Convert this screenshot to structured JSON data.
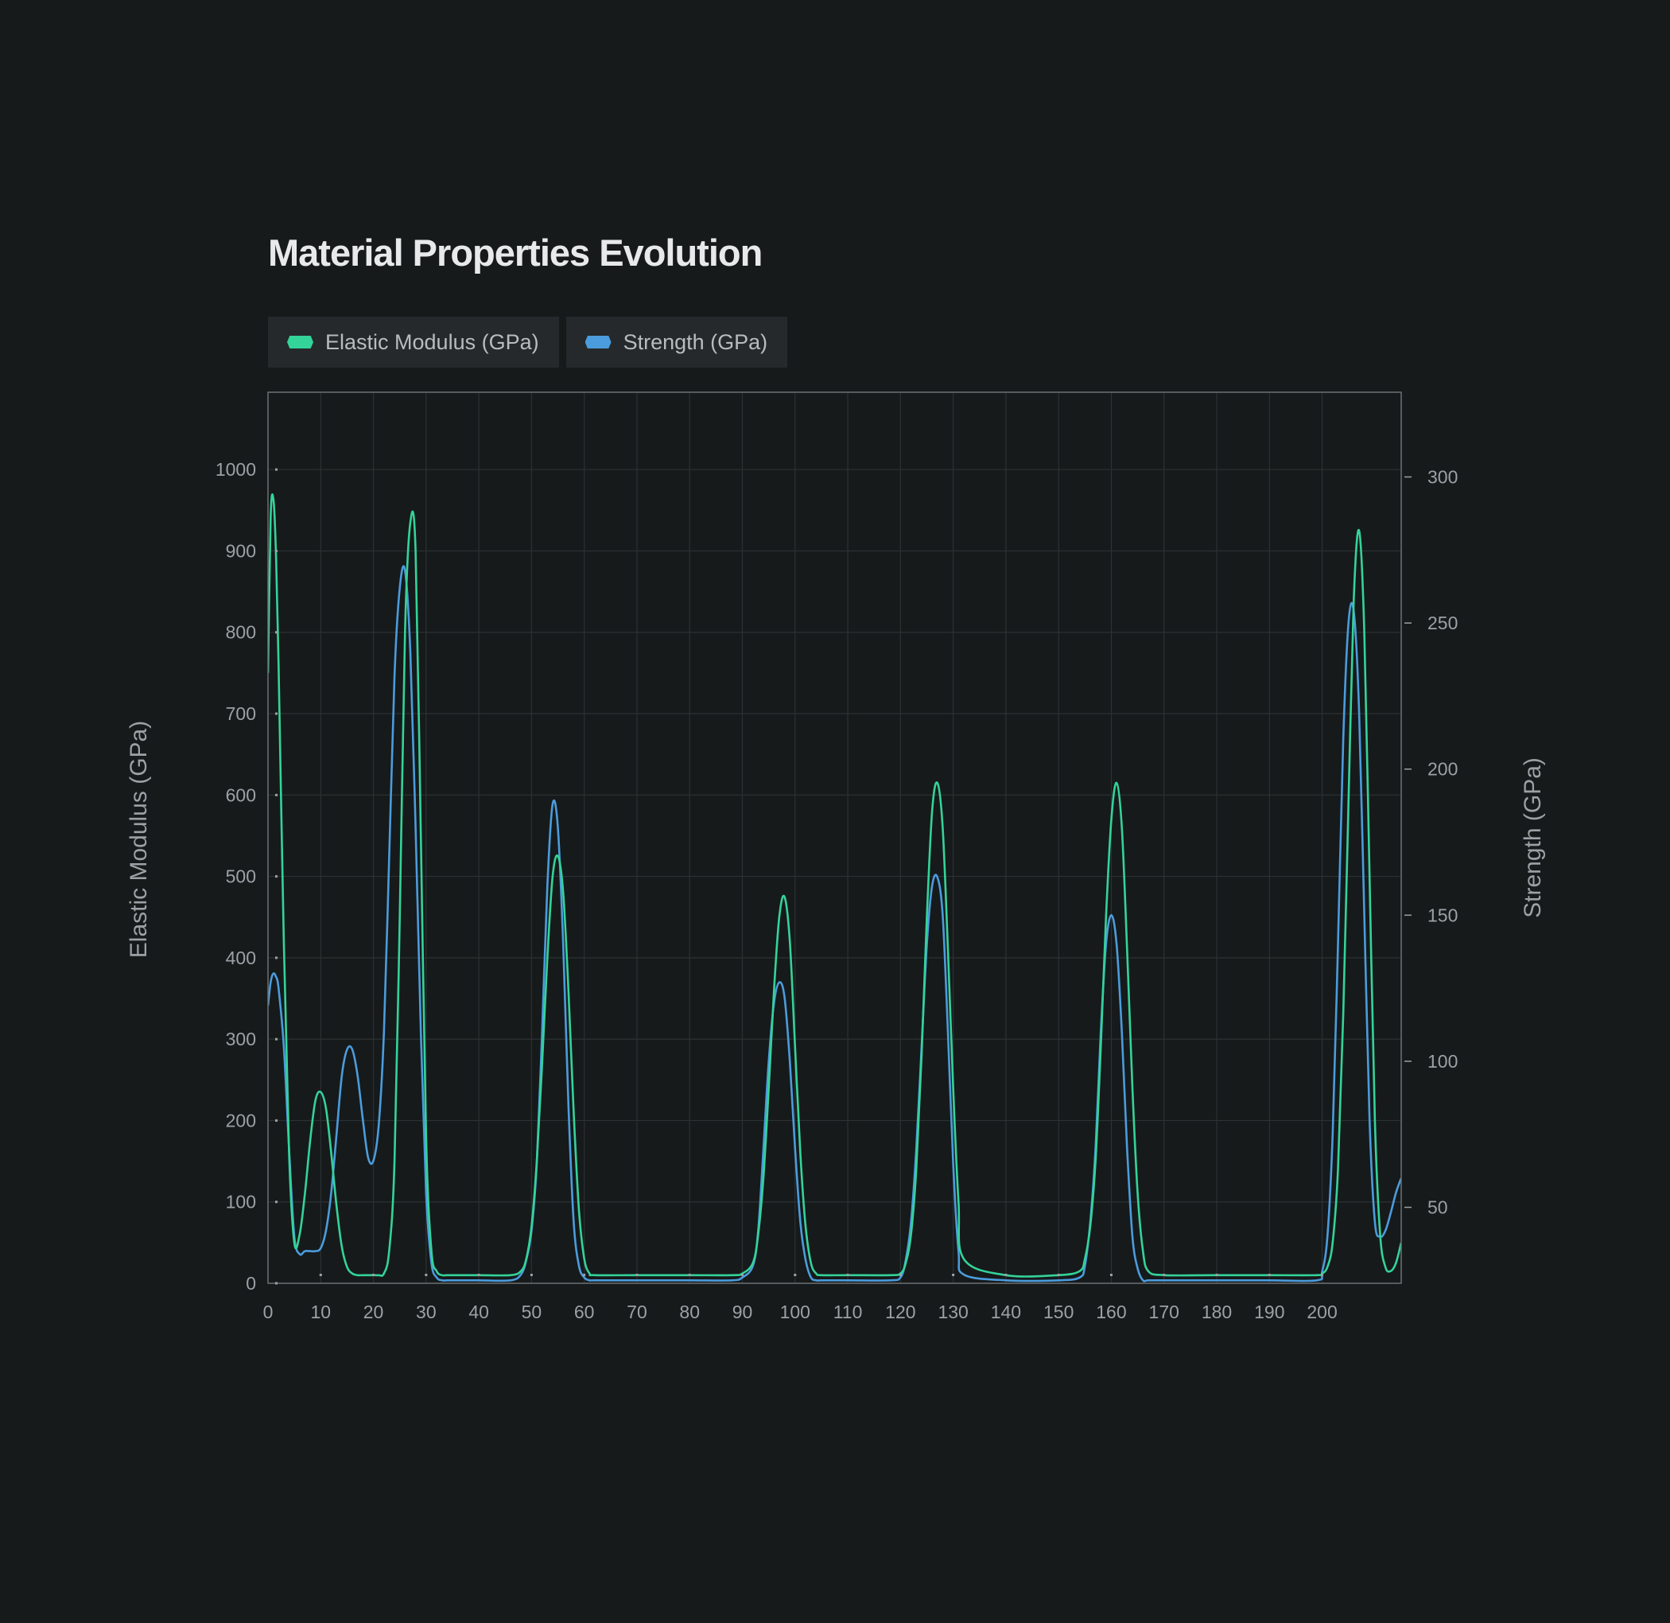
{
  "chart_data": {
    "type": "line",
    "title": "Material Properties Evolution",
    "xlabel": "",
    "ylabel": "Elastic Modulus (GPa)",
    "y2label": "Strength (GPa)",
    "xlim": [
      0,
      215
    ],
    "ylim": [
      0,
      1095
    ],
    "y2lim": [
      24,
      329
    ],
    "x_ticks": [
      0,
      10,
      20,
      30,
      40,
      50,
      60,
      70,
      80,
      90,
      100,
      110,
      120,
      130,
      140,
      150,
      160,
      170,
      180,
      190,
      200
    ],
    "y_ticks": [
      0,
      100,
      200,
      300,
      400,
      500,
      600,
      700,
      800,
      900,
      1000
    ],
    "y2_ticks": [
      50,
      100,
      150,
      200,
      250,
      300
    ],
    "grid": true,
    "legend_position": "top-left",
    "series": [
      {
        "name": "Elastic Modulus (GPa)",
        "axis": "left",
        "color": "#34d399",
        "x": [
          0,
          0.5,
          1,
          1.5,
          2,
          3,
          4,
          5,
          6,
          7,
          8,
          9,
          10,
          11,
          12,
          13,
          14,
          15,
          16,
          17,
          18,
          19,
          20,
          21,
          22,
          23,
          24,
          25,
          26,
          27,
          28,
          29,
          30,
          31,
          32,
          33,
          34,
          35,
          36,
          40,
          46,
          48,
          49,
          50,
          51,
          52,
          53,
          54,
          55,
          56,
          57,
          58,
          59,
          60,
          61,
          62,
          70,
          80,
          88,
          90,
          92,
          93,
          94,
          95,
          96,
          97,
          98,
          99,
          100,
          101,
          102,
          103,
          104,
          105,
          110,
          118,
          120,
          121,
          122,
          123,
          124,
          125,
          126,
          127,
          128,
          129,
          130,
          131,
          132,
          140,
          150,
          154,
          155,
          156,
          157,
          158,
          159,
          160,
          161,
          162,
          163,
          164,
          165,
          166,
          167,
          170,
          180,
          190,
          199,
          200,
          201,
          202,
          203,
          204,
          205,
          206,
          207,
          208,
          209,
          210,
          211,
          212,
          213,
          214,
          215
        ],
        "values": [
          750,
          940,
          965,
          900,
          760,
          420,
          160,
          50,
          60,
          110,
          175,
          225,
          235,
          215,
          160,
          95,
          45,
          20,
          12,
          10,
          10,
          10,
          10,
          10,
          12,
          40,
          150,
          450,
          800,
          935,
          900,
          550,
          180,
          40,
          15,
          10,
          10,
          10,
          10,
          10,
          10,
          15,
          30,
          70,
          150,
          270,
          400,
          500,
          525,
          480,
          360,
          210,
          90,
          30,
          12,
          10,
          10,
          10,
          10,
          12,
          25,
          60,
          130,
          240,
          360,
          450,
          475,
          420,
          290,
          160,
          70,
          25,
          12,
          10,
          10,
          10,
          12,
          25,
          60,
          140,
          280,
          450,
          580,
          615,
          560,
          410,
          240,
          100,
          30,
          10,
          10,
          15,
          30,
          70,
          150,
          290,
          450,
          570,
          615,
          560,
          410,
          240,
          110,
          40,
          15,
          10,
          10,
          10,
          10,
          12,
          20,
          50,
          140,
          330,
          590,
          840,
          925,
          800,
          500,
          200,
          60,
          20,
          15,
          25,
          50
        ]
      },
      {
        "name": "Strength (GPa)",
        "axis": "right",
        "color": "#4b9cdc",
        "x": [
          0,
          0.5,
          1,
          1.5,
          2,
          3,
          4,
          5,
          6,
          7,
          8,
          9,
          10,
          11,
          12,
          13,
          14,
          15,
          16,
          17,
          18,
          19,
          20,
          21,
          22,
          23,
          24,
          25,
          26,
          27,
          28,
          29,
          30,
          31,
          32,
          33,
          34,
          35,
          36,
          40,
          46,
          48,
          49,
          50,
          51,
          52,
          53,
          54,
          55,
          56,
          57,
          58,
          59,
          60,
          61,
          62,
          70,
          80,
          88,
          90,
          92,
          93,
          94,
          95,
          96,
          97,
          98,
          99,
          100,
          101,
          102,
          103,
          104,
          105,
          110,
          118,
          120,
          121,
          122,
          123,
          124,
          125,
          126,
          127,
          128,
          129,
          130,
          131,
          132,
          140,
          150,
          154,
          155,
          156,
          157,
          158,
          159,
          160,
          161,
          162,
          163,
          164,
          165,
          166,
          167,
          170,
          180,
          190,
          199,
          200,
          201,
          202,
          203,
          204,
          205,
          206,
          207,
          208,
          209,
          210,
          211,
          212,
          213,
          214,
          215
        ],
        "values": [
          119,
          127,
          130,
          129,
          125,
          105,
          70,
          40,
          34,
          35,
          35,
          35,
          36,
          42,
          55,
          75,
          95,
          104,
          104,
          95,
          80,
          67,
          66,
          78,
          110,
          170,
          232,
          262,
          268,
          240,
          180,
          110,
          55,
          31,
          26,
          25,
          25,
          25,
          25,
          25,
          25,
          27,
          32,
          42,
          65,
          110,
          160,
          188,
          180,
          140,
          85,
          45,
          30,
          26,
          25,
          25,
          25,
          25,
          25,
          26,
          30,
          42,
          70,
          100,
          120,
          127,
          122,
          100,
          70,
          45,
          32,
          26,
          25,
          25,
          25,
          25,
          26,
          32,
          45,
          70,
          105,
          140,
          160,
          163,
          150,
          110,
          65,
          35,
          27,
          25,
          25,
          26,
          30,
          45,
          70,
          110,
          140,
          150,
          140,
          110,
          70,
          40,
          29,
          25,
          25,
          25,
          25,
          25,
          25,
          28,
          40,
          75,
          140,
          210,
          250,
          254,
          220,
          150,
          80,
          45,
          40,
          42,
          48,
          55,
          60
        ]
      }
    ]
  }
}
